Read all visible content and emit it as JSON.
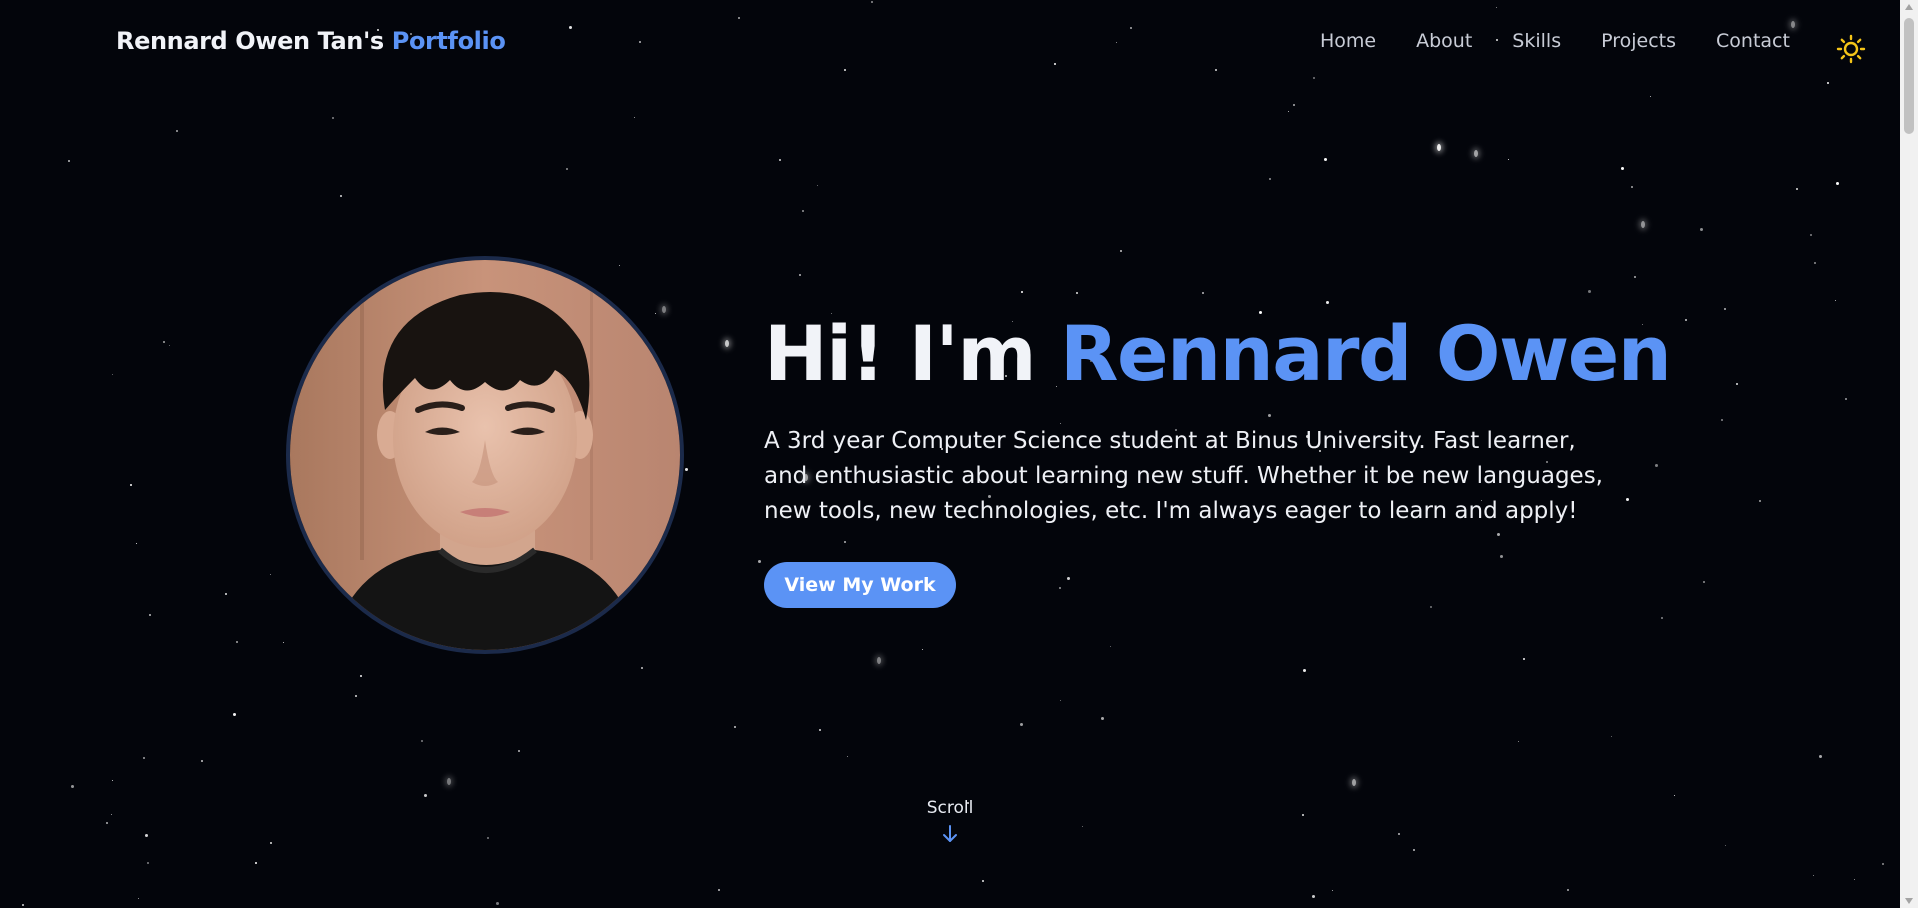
{
  "brand": {
    "name": "Rennard Owen Tan's",
    "accent": "Portfolio"
  },
  "nav": {
    "links": [
      {
        "label": "Home"
      },
      {
        "label": "About"
      },
      {
        "label": "Skills"
      },
      {
        "label": "Projects"
      },
      {
        "label": "Contact"
      }
    ],
    "theme_icon": "sun-icon"
  },
  "hero": {
    "title_prefix": "Hi! I'm ",
    "title_name": "Rennard Owen",
    "description": "A 3rd year Computer Science student at Binus University. Fast learner, and enthusiastic about learning new stuff. Whether it be new languages, new tools, new technologies, etc. I'm always eager to learn and apply!",
    "cta_label": "View My Work"
  },
  "scroll_hint": {
    "label": "Scroll",
    "icon": "arrow-down-icon"
  },
  "colors": {
    "background": "#03050b",
    "accent": "#5b93f5",
    "sun": "#f5c518"
  }
}
